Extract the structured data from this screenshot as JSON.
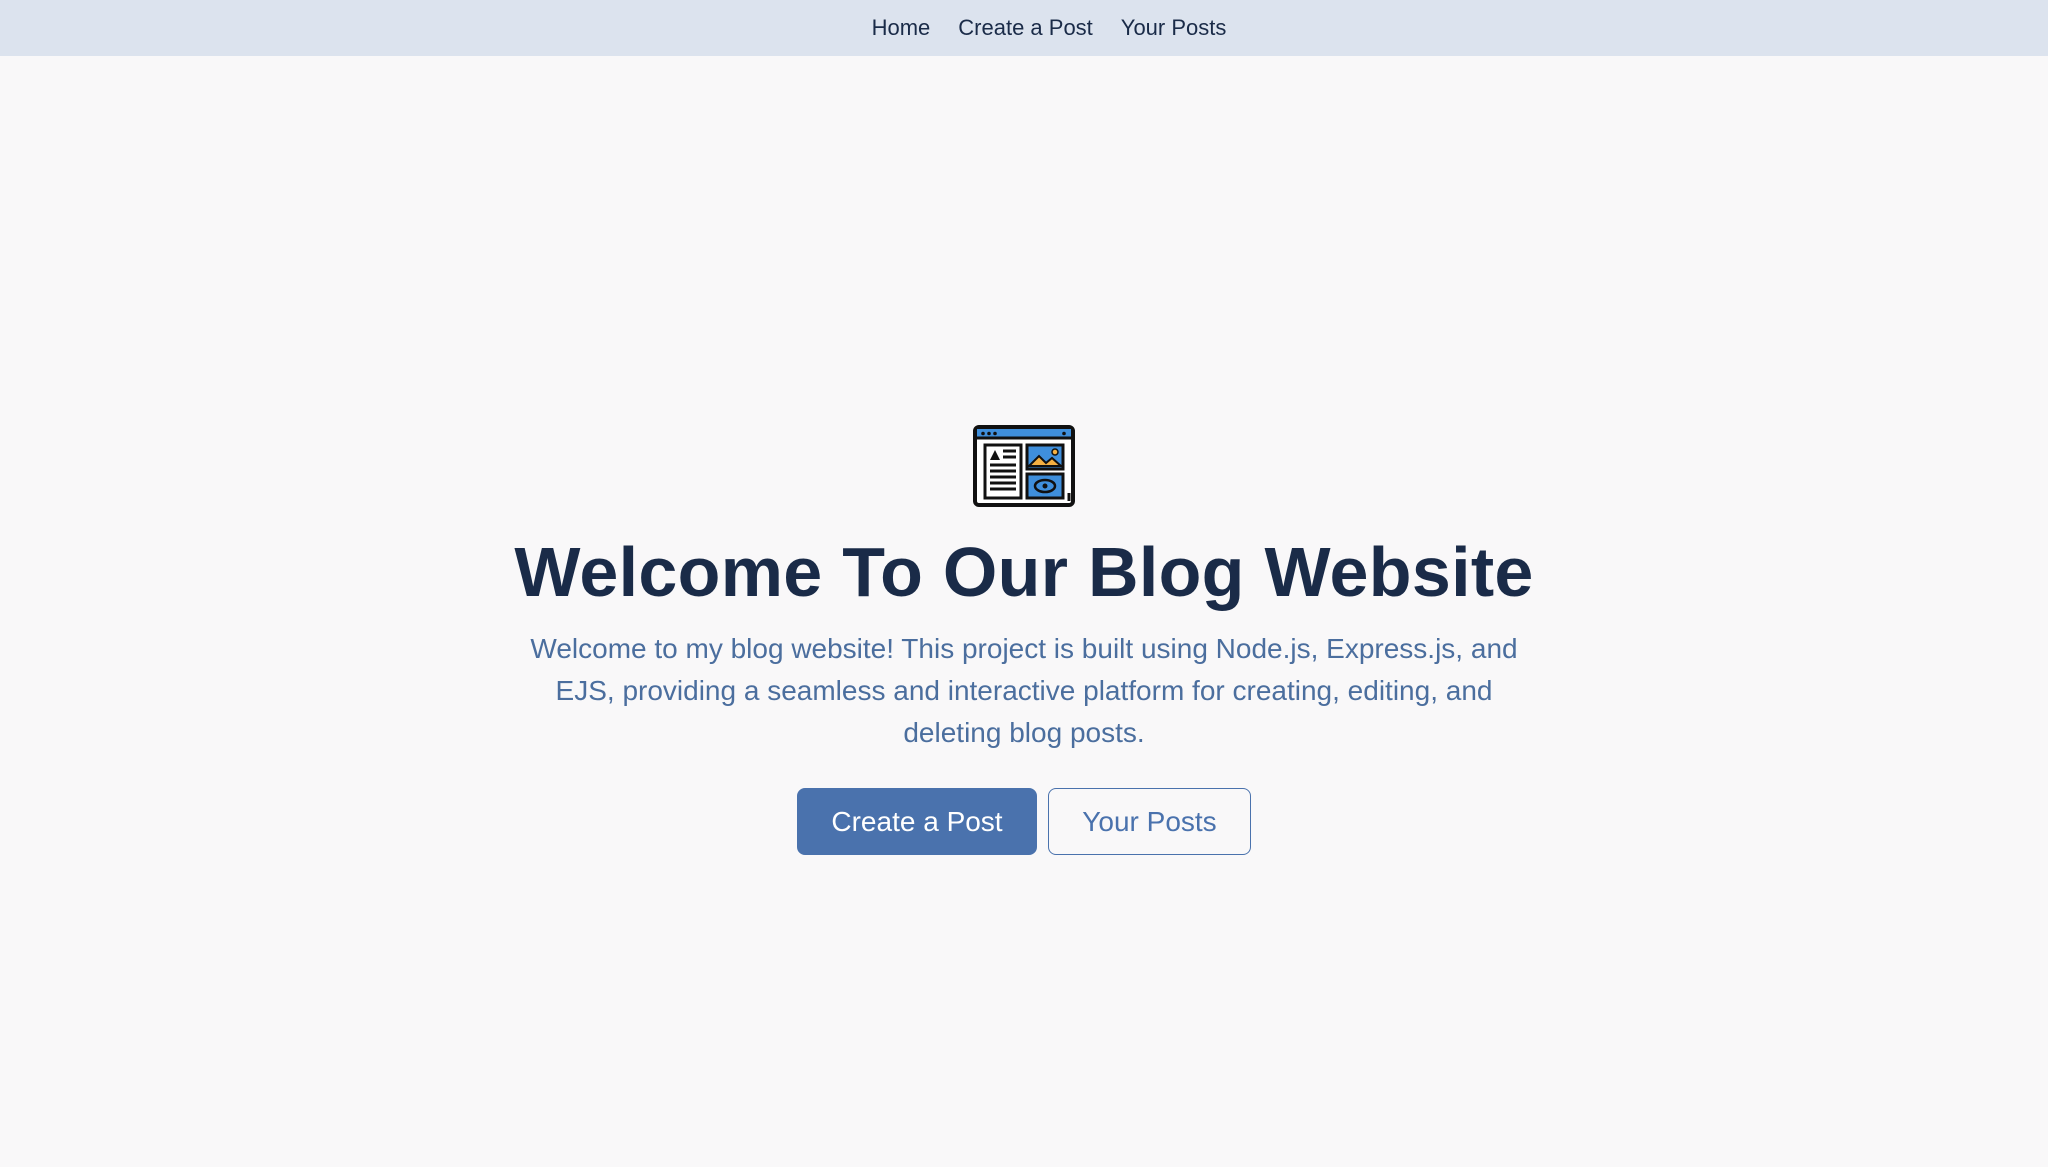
{
  "nav": {
    "items": [
      {
        "label": "Home"
      },
      {
        "label": "Create a Post"
      },
      {
        "label": "Your Posts"
      }
    ]
  },
  "hero": {
    "icon": "blog-layout-icon",
    "title": "Welcome To Our Blog Website",
    "description": "Welcome to my blog website! This project is built using Node.js, Express.js, and EJS, providing a seamless and interactive platform for creating, editing, and deleting blog posts.",
    "primary_button": "Create a Post",
    "secondary_button": "Your Posts"
  },
  "colors": {
    "nav_background": "#dce3ee",
    "page_background": "#f9f8f9",
    "title": "#1a2b48",
    "description": "#4b6e9e",
    "accent": "#4a72ad"
  }
}
